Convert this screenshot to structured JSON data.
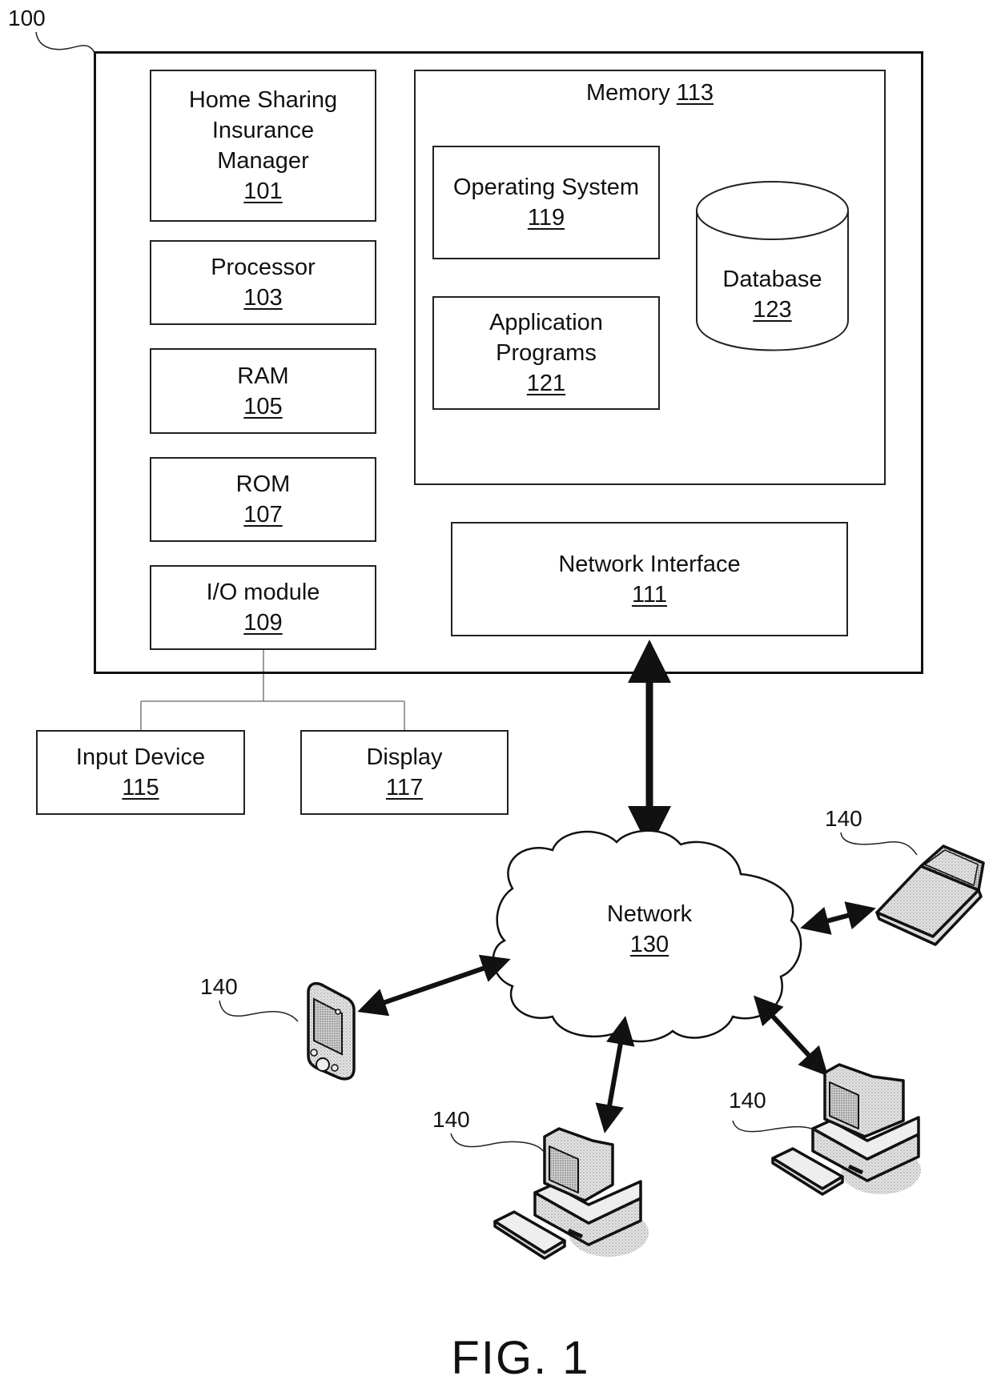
{
  "system": {
    "ref": "100"
  },
  "components": {
    "hsim": {
      "lines": [
        "Home Sharing",
        "Insurance",
        "Manager"
      ],
      "ref": "101"
    },
    "processor": {
      "label": "Processor",
      "ref": "103"
    },
    "ram": {
      "label": "RAM",
      "ref": "105"
    },
    "rom": {
      "label": "ROM",
      "ref": "107"
    },
    "io": {
      "label": "I/O module",
      "ref": "109"
    },
    "memory": {
      "label": "Memory",
      "ref": "113"
    },
    "os": {
      "label": "Operating System",
      "ref": "119"
    },
    "apps": {
      "lines": [
        "Application",
        "Programs"
      ],
      "ref": "121"
    },
    "database": {
      "label": "Database",
      "ref": "123"
    },
    "network_interface": {
      "label": "Network Interface",
      "ref": "111"
    },
    "input_device": {
      "label": "Input Device",
      "ref": "115"
    },
    "display": {
      "label": "Display",
      "ref": "117"
    }
  },
  "network": {
    "label": "Network",
    "ref": "130"
  },
  "devices": [
    {
      "type": "laptop",
      "ref": "140"
    },
    {
      "type": "pda",
      "ref": "140"
    },
    {
      "type": "desktop",
      "ref": "140"
    },
    {
      "type": "desktop",
      "ref": "140"
    }
  ],
  "figure": {
    "caption": "FIG. 1"
  }
}
